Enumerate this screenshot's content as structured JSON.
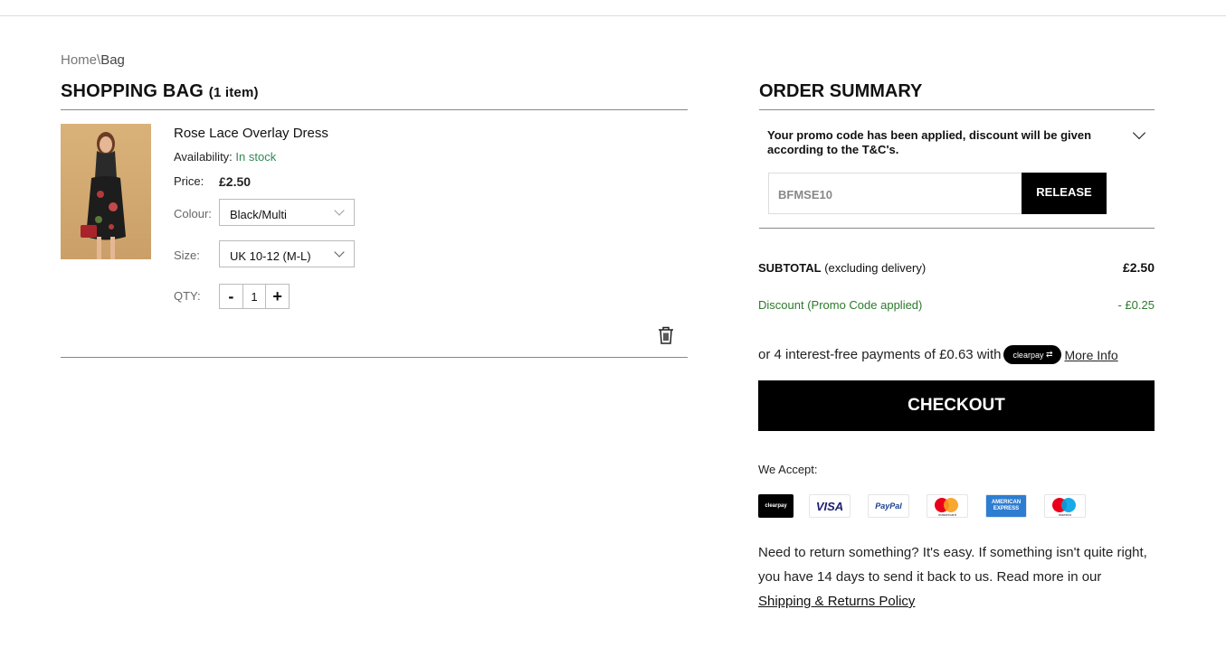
{
  "breadcrumb": {
    "home": "Home",
    "sep": "\\",
    "current": "Bag"
  },
  "bag": {
    "title": "SHOPPING BAG",
    "count": "(1 item)",
    "item": {
      "name": "Rose Lace Overlay Dress",
      "availability_label": "Availability:",
      "availability_value": "In stock",
      "price_label": "Price:",
      "price_value": "£2.50",
      "colour_label": "Colour:",
      "colour_value": "Black/Multi",
      "size_label": "Size:",
      "size_value": "UK 10-12 (M-L)",
      "qty_label": "QTY:",
      "qty_minus": "-",
      "qty_value": "1",
      "qty_plus": "+"
    }
  },
  "summary": {
    "title": "ORDER SUMMARY",
    "promo_message": "Your promo code has been applied, discount will be given according to the T&C's.",
    "promo_code": "BFMSE10",
    "release_label": "RELEASE",
    "subtotal_label": "SUBTOTAL",
    "subtotal_note": "(excluding delivery)",
    "subtotal_value": "£2.50",
    "discount_label": "Discount (Promo Code applied)",
    "discount_value": "- £0.25",
    "clearpay_text": "or 4 interest-free payments of £0.63 with",
    "clearpay_badge": "clearpay",
    "more_info": "More Info",
    "checkout_label": "CHECKOUT",
    "accept_label": "We Accept:",
    "payment_icons": [
      "clearpay",
      "VISA",
      "PayPal",
      "mastercard",
      "AMERICAN EXPRESS",
      "maestro"
    ],
    "returns_text": "Need to return something? It's easy. If something isn't quite right, you have 14 days to send it back to us. Read more in our",
    "returns_link": "Shipping & Returns Policy"
  },
  "colors": {
    "in_stock": "#2f8a55",
    "discount": "#2b7a2b",
    "button_bg": "#000000"
  }
}
